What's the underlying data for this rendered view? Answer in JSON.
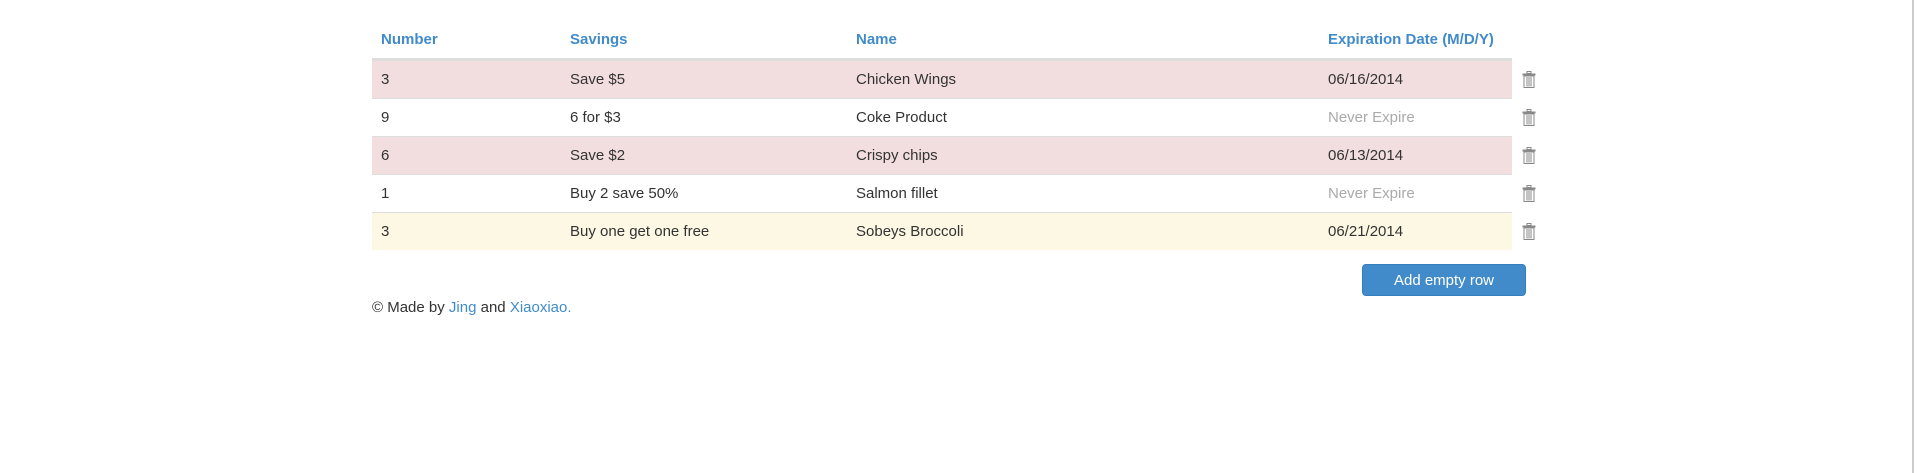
{
  "table": {
    "headers": [
      "Number",
      "Savings",
      "Name",
      "Expiration Date (M/D/Y)"
    ],
    "rows": [
      {
        "number": "3",
        "savings": "Save $5",
        "name": "Chicken Wings",
        "expiration": "06/16/2014",
        "status": "danger"
      },
      {
        "number": "9",
        "savings": "6 for $3",
        "name": "Coke Product",
        "expiration": "Never Expire",
        "status": "none"
      },
      {
        "number": "6",
        "savings": "Save $2",
        "name": "Crispy chips",
        "expiration": "06/13/2014",
        "status": "danger"
      },
      {
        "number": "1",
        "savings": "Buy 2 save 50%",
        "name": "Salmon fillet",
        "expiration": "Never Expire",
        "status": "none"
      },
      {
        "number": "3",
        "savings": "Buy one get one free",
        "name": "Sobeys Broccoli",
        "expiration": "06/21/2014",
        "status": "warning"
      }
    ],
    "row_action_icon": "trash-icon"
  },
  "add_button_label": "Add empty row",
  "footer": {
    "prefix": "© Made by ",
    "author1": "Jing",
    "and": " and ",
    "author2": "Xiaoxiao",
    "suffix": "."
  },
  "colors": {
    "accent": "#428bca",
    "danger_row": "#f2dede",
    "warning_row": "#fcf8e3"
  }
}
